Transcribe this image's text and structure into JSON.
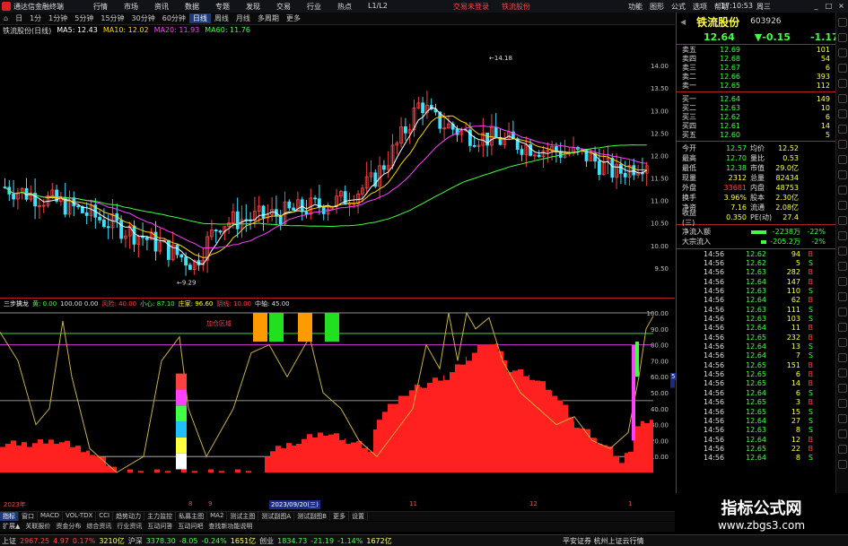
{
  "titlebar": {
    "app_title": "通达信金融终端",
    "menu": [
      "行情",
      "市场",
      "资讯",
      "数据",
      "专题",
      "发现",
      "交易",
      "行业",
      "热点",
      "L1/L2"
    ],
    "center_links": [
      "交易未登录",
      "铁流股份"
    ],
    "right_menu": [
      "功能",
      "图形",
      "公式",
      "选项",
      "帮助"
    ],
    "clock": "17:10:53",
    "weekday": "周三"
  },
  "toolbar": {
    "items": [
      "1分钟",
      "5分钟",
      "15分钟",
      "30分钟",
      "60分钟",
      "日线",
      "周线",
      "月线",
      "多周期",
      "更多"
    ],
    "active_index": 5,
    "pre_items": [
      "日",
      "1分"
    ]
  },
  "infoline": {
    "stock_tag": "铁流股份(日线)",
    "ma5": "MA5: 12.43",
    "ma10": "MA10: 12.02",
    "ma20": "MA20: 11.93",
    "ma60": "MA60: 11.76"
  },
  "kchart_labels": {
    "high_label": "14.18",
    "low_label": "9.29",
    "y_ticks": [
      "14.00",
      "13.50",
      "13.00",
      "12.50",
      "12.00",
      "11.50",
      "11.00",
      "10.50",
      "10.00",
      "9.50"
    ]
  },
  "indicator": {
    "title_sel": "三步擒龙",
    "title_parts": [
      {
        "text": "黄: 0.00",
        "cls": "i1"
      },
      {
        "text": "100.00  0.00",
        "cls": "i2"
      },
      {
        "text": "风险: 40.00",
        "cls": "i3"
      },
      {
        "text": "小心: 87.10",
        "cls": "i1"
      },
      {
        "text": "庄家: 96.60",
        "cls": "i4"
      },
      {
        "text": "阴线: 10.00",
        "cls": "i3"
      },
      {
        "text": "中轴: 45.00",
        "cls": "i2"
      }
    ],
    "label_in_chart": "加仓区域",
    "current_value": "55.84",
    "y_ticks": [
      "100.00",
      "90.00",
      "80.00",
      "70.00",
      "60.00",
      "50.00",
      "40.00",
      "30.00",
      "20.00",
      "10.00"
    ]
  },
  "datebar": {
    "labels": [
      "2023年",
      "8",
      "9",
      "2023/09/20(三)",
      "11",
      "12",
      "1"
    ]
  },
  "tabs": [
    "指标",
    "窗口",
    "MACD",
    "VOL-TDX",
    "CCI",
    "趋势动力",
    "主力监控",
    "私募主图",
    "MA2",
    "测试主图",
    "测试副图A",
    "测试副图B",
    "更多",
    "设置"
  ],
  "tabs_active": 0,
  "tabs2": [
    "扩展▲",
    "关联报价",
    "资金分布",
    "综合资讯",
    "行业资讯",
    "互动问答",
    "互动问吧",
    "查找新功能说明"
  ],
  "status": {
    "sh_label": "上证",
    "sh_value": "2967.25",
    "sh_change": "4.97",
    "sh_pct": "0.17%",
    "sh_amt": "3210亿",
    "sz_label": "沪深",
    "sz_value": "3378.30",
    "sz_change": "-8.05",
    "sz_pct": "-0.24%",
    "sz_amt": "1651亿",
    "cy_label": "创业",
    "cy_value": "1834.73",
    "cy_change": "-21.19",
    "cy_pct": "-1.14%",
    "cy_amt": "1672亿",
    "broker": "平安证券 杭州上证云行情"
  },
  "quote": {
    "name": "铁流股份",
    "code": "603926",
    "price": "12.64",
    "change": "-0.15",
    "pct": "-1.17%",
    "sells": [
      {
        "label": "卖五",
        "price": "12.69",
        "vol": "101"
      },
      {
        "label": "卖四",
        "price": "12.68",
        "vol": "54"
      },
      {
        "label": "卖三",
        "price": "12.67",
        "vol": "6"
      },
      {
        "label": "卖二",
        "price": "12.66",
        "vol": "393"
      },
      {
        "label": "卖一",
        "price": "12.65",
        "vol": "112"
      }
    ],
    "buys": [
      {
        "label": "买一",
        "price": "12.64",
        "vol": "149"
      },
      {
        "label": "买二",
        "price": "12.63",
        "vol": "10"
      },
      {
        "label": "买三",
        "price": "12.62",
        "vol": "6"
      },
      {
        "label": "买四",
        "price": "12.61",
        "vol": "14"
      },
      {
        "label": "买五",
        "price": "12.60",
        "vol": "5"
      }
    ],
    "stats": [
      {
        "k1": "今开",
        "v1": "12.57",
        "c1": "g",
        "k2": "均价",
        "v2": "12.52"
      },
      {
        "k1": "最高",
        "v1": "12.70",
        "c1": "g",
        "k2": "量比",
        "v2": "0.53"
      },
      {
        "k1": "最低",
        "v1": "12.38",
        "c1": "g",
        "k2": "市值",
        "v2": "29.0亿"
      },
      {
        "k1": "现量",
        "v1": "2312",
        "c1": "y",
        "k2": "总量",
        "v2": "82434"
      },
      {
        "k1": "外盘",
        "v1": "33681",
        "c1": "r",
        "k2": "内盘",
        "v2": "48753"
      },
      {
        "k1": "换手",
        "v1": "3.96%",
        "c1": "y",
        "k2": "股本",
        "v2": "2.30亿"
      },
      {
        "k1": "净资",
        "v1": "7.16",
        "c1": "y",
        "k2": "流通",
        "v2": "2.08亿"
      },
      {
        "k1": "收益(三)",
        "v1": "0.350",
        "c1": "y",
        "k2": "PE(动)",
        "v2": "27.4"
      }
    ],
    "flows": [
      {
        "k": "净流入额",
        "v": "-2238万",
        "p": "-22%",
        "bar": 0.35
      },
      {
        "k": "大宗流入",
        "v": "-205.2万",
        "p": "-2%",
        "bar": 0.12
      }
    ],
    "ticks": [
      {
        "t": "14:56",
        "px": "12.62",
        "vol": "94",
        "side": "B"
      },
      {
        "t": "14:56",
        "px": "12.62",
        "vol": "5",
        "side": "S"
      },
      {
        "t": "14:56",
        "px": "12.63",
        "vol": "282",
        "side": "B"
      },
      {
        "t": "14:56",
        "px": "12.64",
        "vol": "147",
        "side": "B"
      },
      {
        "t": "14:56",
        "px": "12.63",
        "vol": "110",
        "side": "S"
      },
      {
        "t": "14:56",
        "px": "12.64",
        "vol": "62",
        "side": "B"
      },
      {
        "t": "14:56",
        "px": "12.63",
        "vol": "111",
        "side": "S"
      },
      {
        "t": "14:56",
        "px": "12.63",
        "vol": "103",
        "side": "S"
      },
      {
        "t": "14:56",
        "px": "12.64",
        "vol": "11",
        "side": "B"
      },
      {
        "t": "14:56",
        "px": "12.65",
        "vol": "232",
        "side": "B"
      },
      {
        "t": "14:56",
        "px": "12.64",
        "vol": "13",
        "side": "S"
      },
      {
        "t": "14:56",
        "px": "12.64",
        "vol": "7",
        "side": "S"
      },
      {
        "t": "14:56",
        "px": "12.65",
        "vol": "151",
        "side": "B"
      },
      {
        "t": "14:56",
        "px": "12.65",
        "vol": "6",
        "side": "B"
      },
      {
        "t": "14:56",
        "px": "12.65",
        "vol": "14",
        "side": "B"
      },
      {
        "t": "14:56",
        "px": "12.64",
        "vol": "6",
        "side": "S"
      },
      {
        "t": "14:56",
        "px": "12.65",
        "vol": "3",
        "side": "B"
      },
      {
        "t": "14:56",
        "px": "12.65",
        "vol": "15",
        "side": "S"
      },
      {
        "t": "14:56",
        "px": "12.64",
        "vol": "27",
        "side": "S"
      },
      {
        "t": "14:56",
        "px": "12.63",
        "vol": "8",
        "side": "S"
      },
      {
        "t": "14:56",
        "px": "12.64",
        "vol": "12",
        "side": "B"
      },
      {
        "t": "14:56",
        "px": "12.65",
        "vol": "22",
        "side": "B"
      },
      {
        "t": "14:56",
        "px": "12.64",
        "vol": "8",
        "side": "S"
      }
    ]
  },
  "watermark": {
    "line1": "指标公式网",
    "line2": "www.zbgs3.com"
  },
  "colors": {
    "up": "#ff4040",
    "down": "#40ff40",
    "ma5": "#ffffff",
    "ma10": "#ffd700",
    "ma20": "#ff40ff",
    "ma60": "#40ff40",
    "accent": "#b02020"
  }
}
